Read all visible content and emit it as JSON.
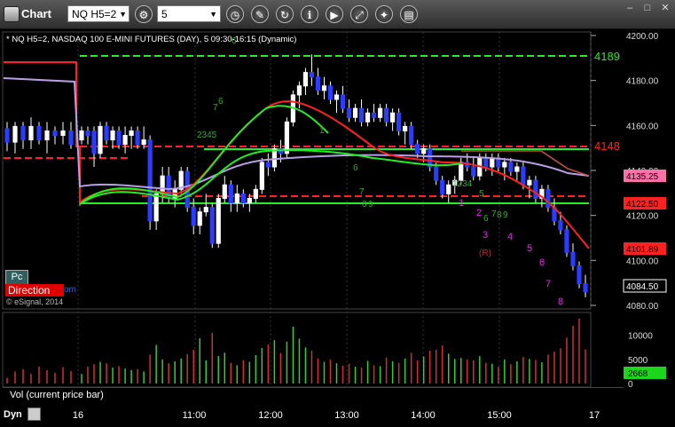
{
  "app": {
    "title": "Chart"
  },
  "toolbar": {
    "symbol": "NQ H5=2",
    "interval": "5",
    "tools": [
      {
        "name": "gear-icon",
        "glyph": "⚙"
      },
      {
        "name": "clock-icon",
        "glyph": "◷"
      },
      {
        "name": "pencil-icon",
        "glyph": "✎"
      },
      {
        "name": "draw-tools-icon",
        "glyph": "↻"
      },
      {
        "name": "format-icon",
        "glyph": "ℹ"
      },
      {
        "name": "play-icon",
        "glyph": "▶"
      },
      {
        "name": "link-icon",
        "glyph": "⤢"
      },
      {
        "name": "star-icon",
        "glyph": "✦"
      },
      {
        "name": "clipboard-icon",
        "glyph": "▤"
      }
    ],
    "window_controls": [
      "–",
      "□",
      "✕"
    ]
  },
  "chart": {
    "legend": "* NQ H5=2, NASDAQ 100 E-MINI FUTURES (DAY), 5 09:30-16:15 (Dynamic)",
    "watermark": "© eSignal, 2014",
    "pc_label": "Pc",
    "direction_label": "Direction",
    "direction_tail": "om",
    "volume_label": "Vol (current price bar)",
    "dyn_label": "Dyn"
  },
  "colors": {
    "up_candle": "#ffffff",
    "down_candle": "#2a3cff",
    "green_line": "#22ee22",
    "red_line": "#ff2020",
    "ma_purple": "#b9a0e6",
    "magenta": "#ee22ee"
  },
  "chart_data": {
    "type": "candlestick",
    "price_axis": {
      "min": 4080,
      "max": 4200,
      "ticks": [
        4200.0,
        4180.0,
        4160.0,
        4140.0,
        4120.0,
        4100.0,
        4080.0
      ]
    },
    "time_axis": {
      "ticks": [
        "16",
        "11:00",
        "12:00",
        "13:00",
        "14:00",
        "15:00",
        "17"
      ]
    },
    "price_tags": [
      {
        "label": "4135.25",
        "value": 4135.25,
        "color": "#ff6fa8"
      },
      {
        "label": "4122.50",
        "value": 4122.5,
        "color": "#ff2020"
      },
      {
        "label": "4101.89",
        "value": 4101.89,
        "color": "#ff2020"
      },
      {
        "label": "4084.50",
        "value": 4084.5,
        "color": "#ffffff"
      }
    ],
    "level_labels": [
      {
        "text": "4189",
        "value": 4189,
        "color": "#22ee22"
      },
      {
        "text": "4148",
        "value": 4148,
        "color": "#ff2020"
      }
    ],
    "volume_axis": {
      "max": 14000,
      "ticks": [
        10000,
        5000,
        0
      ],
      "current": "2668"
    },
    "candles": [
      [
        4152,
        4158,
        4150,
        4156
      ],
      [
        4156,
        4158,
        4150,
        4154
      ],
      [
        4156,
        4158,
        4140,
        4146
      ],
      [
        4146,
        4160,
        4144,
        4158
      ],
      [
        4158,
        4160,
        4150,
        4152
      ],
      [
        4152,
        4158,
        4148,
        4156
      ],
      [
        4156,
        4158,
        4148,
        4150
      ],
      [
        4150,
        4158,
        4146,
        4154
      ],
      [
        4154,
        4158,
        4148,
        4156
      ],
      [
        4156,
        4158,
        4148,
        4150
      ],
      [
        4150,
        4158,
        4148,
        4152
      ],
      [
        4152,
        4154,
        4112,
        4116
      ],
      [
        4116,
        4130,
        4112,
        4128
      ],
      [
        4128,
        4140,
        4124,
        4136
      ],
      [
        4136,
        4140,
        4124,
        4126
      ],
      [
        4126,
        4134,
        4122,
        4130
      ],
      [
        4130,
        4140,
        4128,
        4138
      ],
      [
        4138,
        4140,
        4120,
        4122
      ],
      [
        4122,
        4126,
        4110,
        4114
      ],
      [
        4114,
        4122,
        4110,
        4120
      ],
      [
        4120,
        4128,
        4118,
        4122
      ],
      [
        4122,
        4124,
        4104,
        4106
      ],
      [
        4106,
        4128,
        4104,
        4126
      ],
      [
        4126,
        4136,
        4124,
        4132
      ],
      [
        4132,
        4134,
        4120,
        4124
      ],
      [
        4124,
        4132,
        4120,
        4128
      ],
      [
        4128,
        4130,
        4122,
        4124
      ],
      [
        4124,
        4128,
        4120,
        4126
      ],
      [
        4126,
        4132,
        4124,
        4130
      ],
      [
        4130,
        4144,
        4128,
        4142
      ],
      [
        4142,
        4146,
        4136,
        4140
      ],
      [
        4140,
        4150,
        4138,
        4148
      ],
      [
        4148,
        4152,
        4142,
        4146
      ],
      [
        4146,
        4162,
        4144,
        4160
      ],
      [
        4160,
        4174,
        4158,
        4172
      ],
      [
        4172,
        4178,
        4166,
        4176
      ],
      [
        4176,
        4184,
        4172,
        4182
      ],
      [
        4182,
        4190,
        4176,
        4180
      ],
      [
        4180,
        4184,
        4172,
        4174
      ],
      [
        4174,
        4180,
        4170,
        4176
      ],
      [
        4176,
        4178,
        4168,
        4170
      ],
      [
        4170,
        4174,
        4164,
        4172
      ],
      [
        4172,
        4176,
        4164,
        4166
      ],
      [
        4166,
        4170,
        4160,
        4162
      ],
      [
        4162,
        4168,
        4160,
        4166
      ],
      [
        4166,
        4170,
        4158,
        4160
      ],
      [
        4160,
        4166,
        4158,
        4164
      ],
      [
        4164,
        4168,
        4160,
        4162
      ],
      [
        4162,
        4168,
        4160,
        4166
      ],
      [
        4166,
        4168,
        4158,
        4160
      ],
      [
        4160,
        4166,
        4156,
        4164
      ],
      [
        4164,
        4166,
        4154,
        4156
      ],
      [
        4156,
        4160,
        4150,
        4158
      ],
      [
        4158,
        4160,
        4148,
        4150
      ],
      [
        4150,
        4152,
        4144,
        4146
      ],
      [
        4146,
        4150,
        4142,
        4148
      ],
      [
        4148,
        4150,
        4138,
        4140
      ],
      [
        4140,
        4142,
        4132,
        4134
      ],
      [
        4134,
        4136,
        4126,
        4128
      ],
      [
        4128,
        4134,
        4124,
        4132
      ],
      [
        4132,
        4136,
        4128,
        4134
      ],
      [
        4134,
        4144,
        4132,
        4142
      ],
      [
        4142,
        4146,
        4138,
        4140
      ],
      [
        4140,
        4144,
        4134,
        4136
      ],
      [
        4136,
        4146,
        4134,
        4144
      ],
      [
        4144,
        4146,
        4138,
        4140
      ],
      [
        4140,
        4146,
        4136,
        4144
      ],
      [
        4144,
        4146,
        4138,
        4140
      ],
      [
        4140,
        4144,
        4134,
        4142
      ],
      [
        4142,
        4144,
        4136,
        4138
      ],
      [
        4138,
        4142,
        4134,
        4140
      ],
      [
        4140,
        4142,
        4130,
        4132
      ],
      [
        4132,
        4136,
        4126,
        4134
      ],
      [
        4134,
        4136,
        4124,
        4126
      ],
      [
        4126,
        4132,
        4122,
        4130
      ],
      [
        4130,
        4132,
        4120,
        4122
      ],
      [
        4122,
        4126,
        4114,
        4116
      ],
      [
        4116,
        4120,
        4110,
        4112
      ],
      [
        4112,
        4114,
        4100,
        4102
      ],
      [
        4102,
        4106,
        4094,
        4096
      ],
      [
        4096,
        4098,
        4086,
        4088
      ],
      [
        4088,
        4092,
        4082,
        4084.5
      ]
    ],
    "volumes": [
      2000,
      3500,
      4000,
      4500,
      4200,
      3300,
      3600,
      3100,
      2800,
      3000,
      2500,
      6000,
      8000,
      5000,
      4200,
      4600,
      5200,
      6100,
      7000,
      9400,
      4800,
      10500,
      5700,
      6400,
      4300,
      3800,
      4800,
      4500,
      5900,
      7400,
      8100,
      9000,
      6300,
      8700,
      11800,
      9300,
      7500,
      6800,
      5200,
      4500,
      5000,
      4200,
      3700,
      4100,
      3500,
      3300,
      4700,
      3800,
      3600,
      5400,
      4600,
      4300,
      5200,
      6400,
      4800,
      5600,
      6800,
      7000,
      7900,
      6200,
      5100,
      5300,
      5000,
      4800,
      5700,
      4300,
      4100,
      3500,
      5000,
      4000,
      4600,
      5500,
      5100,
      4900,
      4400,
      6000,
      6600,
      7300,
      9500,
      12000,
      13500,
      7100
    ]
  }
}
